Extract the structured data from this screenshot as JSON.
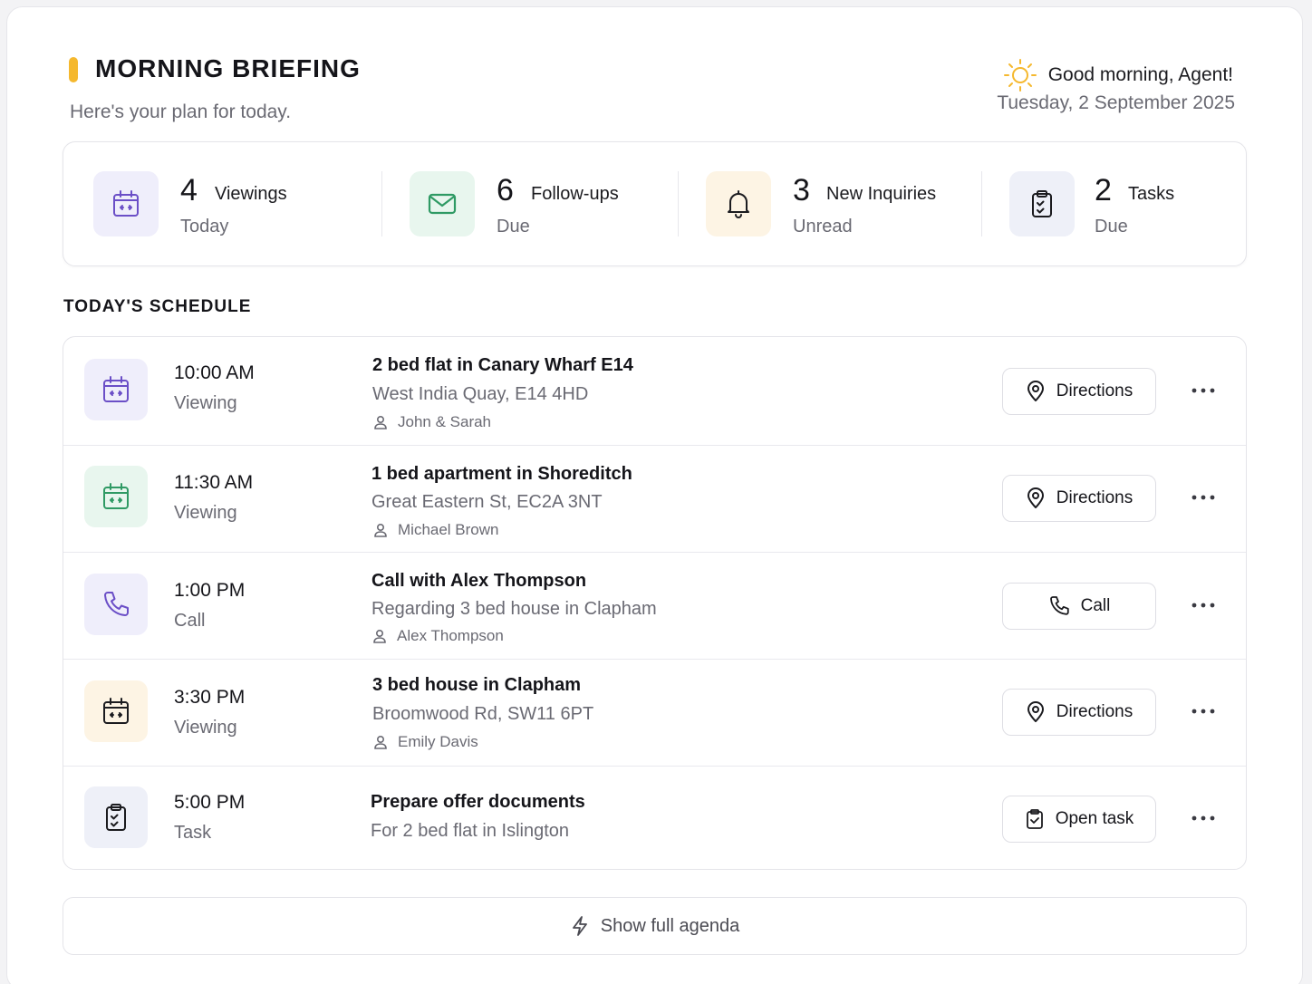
{
  "header": {
    "title": "MORNING BRIEFING",
    "subtitle": "Here's your plan for today.",
    "greeting": "Good morning, Agent!",
    "date": "Tuesday, 2 September 2025",
    "accent_color": "#f5b82e",
    "greeting_icon": "sun-icon"
  },
  "stats": [
    {
      "value": "4",
      "label": "Viewings",
      "sub": "Today",
      "icon": "calendar-icon",
      "color": "#6b4fc7",
      "bg": "#efeefb"
    },
    {
      "value": "6",
      "label": "Follow-ups",
      "sub": "Due",
      "icon": "mail-icon",
      "color": "#2f9a64",
      "bg": "#e8f6ee"
    },
    {
      "value": "3",
      "label": "New Inquiries",
      "sub": "Unread",
      "icon": "bell-icon",
      "color": "#1b1b1f",
      "bg": "#fdf4e4"
    },
    {
      "value": "2",
      "label": "Tasks",
      "sub": "Due",
      "icon": "clipboard-check-icon",
      "color": "#1b1b1f",
      "bg": "#eef0f8"
    }
  ],
  "schedule": {
    "title": "TODAY'S SCHEDULE",
    "items": [
      {
        "time": "10:00 AM",
        "type": "Viewing",
        "title": "2 bed flat in Canary Wharf E14",
        "subtitle": "West India Quay, E14 4HD",
        "person": "John & Sarah",
        "action": "Directions",
        "icon": "calendar-icon",
        "color": "#6b4fc7",
        "bg": "#efeefb"
      },
      {
        "time": "11:30 AM",
        "type": "Viewing",
        "title": "1 bed apartment in Shoreditch",
        "subtitle": "Great Eastern St, EC2A 3NT",
        "person": "Michael Brown",
        "action": "Directions",
        "icon": "calendar-icon",
        "color": "#2f9a64",
        "bg": "#e8f6ee"
      },
      {
        "time": "1:00 PM",
        "type": "Call",
        "title": "Call with Alex Thompson",
        "subtitle": "Regarding 3 bed house in Clapham",
        "person": "Alex Thompson",
        "action": "Call",
        "icon": "phone-icon",
        "color": "#6b4fc7",
        "bg": "#efeefb"
      },
      {
        "time": "3:30 PM",
        "type": "Viewing",
        "title": "3 bed house in Clapham",
        "subtitle": "Broomwood Rd, SW11 6PT",
        "person": "Emily Davis",
        "action": "Directions",
        "icon": "calendar-icon",
        "color": "#1b1b1f",
        "bg": "#fdf4e4"
      },
      {
        "time": "5:00 PM",
        "type": "Task",
        "title": "Prepare offer documents",
        "subtitle": "For 2 bed flat in Islington",
        "person": "",
        "action": "Open task",
        "icon": "clipboard-check-icon",
        "color": "#1b1b1f",
        "bg": "#eef0f8"
      }
    ]
  },
  "footer": {
    "agenda_label": "Show full agenda",
    "agenda_icon": "lightning-icon"
  }
}
